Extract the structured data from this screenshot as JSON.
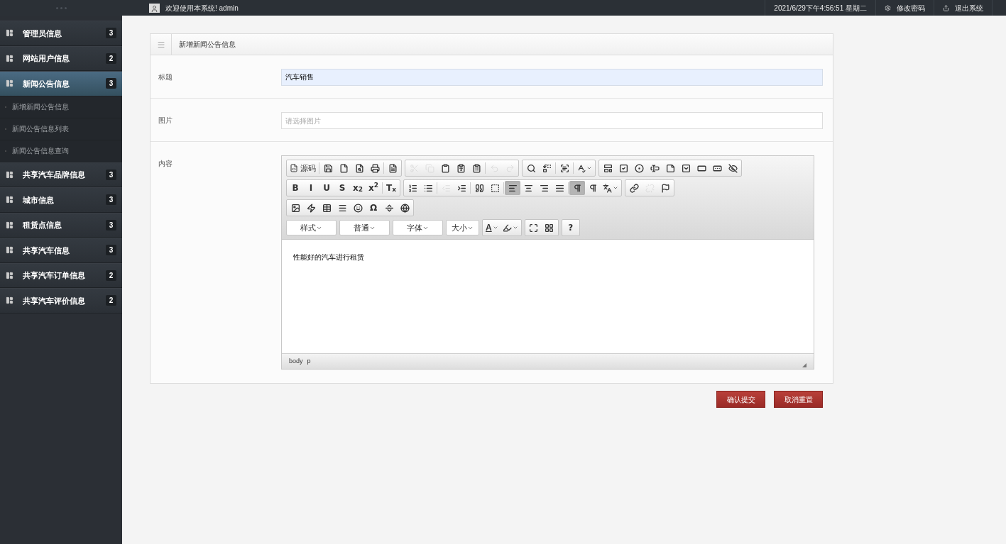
{
  "topbar": {
    "welcome": "欢迎使用本系统! admin",
    "datetime": "2021/6/29下午4:56:51 星期二",
    "links": [
      {
        "kind": "password",
        "label": "修改密码"
      },
      {
        "kind": "logout",
        "label": "退出系统"
      }
    ]
  },
  "sidebar": {
    "items": [
      {
        "label": "管理员信息",
        "count": "3",
        "selected": false
      },
      {
        "label": "网站用户信息",
        "count": "2",
        "selected": false
      },
      {
        "label": "新闻公告信息",
        "count": "3",
        "selected": true,
        "children": [
          {
            "label": "新增新闻公告信息",
            "selected": false
          },
          {
            "label": "新闻公告信息列表",
            "selected": false
          },
          {
            "label": "新闻公告信息查询",
            "selected": false
          }
        ]
      },
      {
        "label": "共享汽车品牌信息",
        "count": "3",
        "selected": false
      },
      {
        "label": "城市信息",
        "count": "3",
        "selected": false
      },
      {
        "label": "租赁点信息",
        "count": "3",
        "selected": false
      },
      {
        "label": "共享汽车信息",
        "count": "3",
        "selected": false
      },
      {
        "label": "共享汽车订单信息",
        "count": "2",
        "selected": false
      },
      {
        "label": "共享汽车评价信息",
        "count": "2",
        "selected": false
      }
    ]
  },
  "form": {
    "title": "新增新闻公告信息",
    "fields": [
      {
        "kind": "text",
        "label": "标题",
        "value": "汽车销售",
        "highlighted": true
      },
      {
        "kind": "text",
        "label": "图片",
        "placeholder": "请选择图片",
        "highlighted": false
      },
      {
        "kind": "editor",
        "label": "内容",
        "value": "性能好的汽车进行租赁",
        "path": [
          "body",
          "p"
        ],
        "toolbar": [
          {
            "groups": [
              {
                "segments": [
                  [
                    {
                      "kind": "text-icon",
                      "label": "源码",
                      "selected": false,
                      "disabled": false
                    }
                  ],
                  [
                    {
                      "kind": "icon",
                      "selected": false,
                      "disabled": false
                    },
                    {
                      "kind": "icon",
                      "selected": false,
                      "disabled": false
                    },
                    {
                      "kind": "icon",
                      "selected": false,
                      "disabled": false
                    },
                    {
                      "kind": "icon",
                      "selected": false,
                      "disabled": false
                    }
                  ],
                  [
                    {
                      "kind": "icon",
                      "selected": false,
                      "disabled": false
                    }
                  ]
                ]
              },
              {
                "segments": [
                  [
                    {
                      "kind": "icon",
                      "selected": false,
                      "disabled": true
                    },
                    {
                      "kind": "icon",
                      "selected": false,
                      "disabled": true
                    },
                    {
                      "kind": "icon",
                      "selected": false,
                      "disabled": false
                    },
                    {
                      "kind": "icon",
                      "selected": false,
                      "disabled": false
                    },
                    {
                      "kind": "icon",
                      "selected": false,
                      "disabled": false
                    }
                  ],
                  [
                    {
                      "kind": "icon",
                      "selected": false,
                      "disabled": true
                    },
                    {
                      "kind": "icon",
                      "selected": false,
                      "disabled": true
                    }
                  ]
                ]
              },
              {
                "segments": [
                  [
                    {
                      "kind": "icon",
                      "selected": false,
                      "disabled": false
                    },
                    {
                      "kind": "icon",
                      "selected": false,
                      "disabled": false
                    }
                  ],
                  [
                    {
                      "kind": "icon",
                      "selected": false,
                      "disabled": false
                    }
                  ],
                  [
                    {
                      "kind": "icon-menu",
                      "selected": false,
                      "disabled": false
                    }
                  ]
                ]
              },
              {
                "segments": [
                  [
                    {
                      "kind": "icon",
                      "selected": false,
                      "disabled": false
                    },
                    {
                      "kind": "icon",
                      "selected": false,
                      "disabled": false
                    },
                    {
                      "kind": "icon",
                      "selected": false,
                      "disabled": false
                    },
                    {
                      "kind": "icon",
                      "selected": false,
                      "disabled": false
                    },
                    {
                      "kind": "icon",
                      "selected": false,
                      "disabled": false
                    },
                    {
                      "kind": "icon",
                      "selected": false,
                      "disabled": false
                    },
                    {
                      "kind": "icon",
                      "selected": false,
                      "disabled": false
                    },
                    {
                      "kind": "icon",
                      "selected": false,
                      "disabled": false
                    },
                    {
                      "kind": "icon",
                      "selected": false,
                      "disabled": false
                    }
                  ]
                ]
              }
            ]
          },
          {
            "groups": [
              {
                "segments": [
                  [
                    {
                      "kind": "text",
                      "label": "B",
                      "selected": false,
                      "disabled": false
                    },
                    {
                      "kind": "text",
                      "label": "I",
                      "selected": false,
                      "disabled": false
                    },
                    {
                      "kind": "text",
                      "label": "U",
                      "selected": false,
                      "disabled": false
                    },
                    {
                      "kind": "text",
                      "label": "S",
                      "selected": false,
                      "disabled": false
                    },
                    {
                      "kind": "text",
                      "label": "x$_{2}$",
                      "selected": false,
                      "disabled": false
                    },
                    {
                      "kind": "text",
                      "label": "x$^{2}$",
                      "selected": false,
                      "disabled": false
                    }
                  ],
                  [
                    {
                      "kind": "text",
                      "label": "T$_{x}$",
                      "selected": false,
                      "disabled": false
                    }
                  ]
                ]
              },
              {
                "segments": [
                  [
                    {
                      "kind": "icon",
                      "selected": false,
                      "disabled": false
                    },
                    {
                      "kind": "icon",
                      "selected": false,
                      "disabled": false
                    }
                  ],
                  [
                    {
                      "kind": "icon",
                      "selected": false,
                      "disabled": true
                    },
                    {
                      "kind": "icon",
                      "selected": false,
                      "disabled": false
                    }
                  ],
                  [
                    {
                      "kind": "icon",
                      "selected": false,
                      "disabled": false
                    },
                    {
                      "kind": "icon",
                      "selected": false,
                      "disabled": false
                    }
                  ],
                  [
                    {
                      "kind": "icon",
                      "selected": true,
                      "disabled": false
                    },
                    {
                      "kind": "icon",
                      "selected": false,
                      "disabled": false
                    },
                    {
                      "kind": "icon",
                      "selected": false,
                      "disabled": false
                    },
                    {
                      "kind": "icon",
                      "selected": false,
                      "disabled": false
                    }
                  ],
                  [
                    {
                      "kind": "icon",
                      "selected": true,
                      "disabled": false
                    },
                    {
                      "kind": "icon",
                      "selected": false,
                      "disabled": false
                    },
                    {
                      "kind": "icon-menu",
                      "selected": false,
                      "disabled": false
                    }
                  ]
                ]
              },
              {
                "segments": [
                  [
                    {
                      "kind": "icon",
                      "selected": false,
                      "disabled": false
                    },
                    {
                      "kind": "icon",
                      "selected": false,
                      "disabled": true
                    },
                    {
                      "kind": "icon",
                      "selected": false,
                      "disabled": false
                    }
                  ]
                ]
              }
            ]
          },
          {
            "groups": [
              {
                "segments": [
                  [
                    {
                      "kind": "icon",
                      "selected": false,
                      "disabled": false
                    },
                    {
                      "kind": "icon",
                      "selected": false,
                      "disabled": false
                    },
                    {
                      "kind": "icon",
                      "selected": false,
                      "disabled": false
                    },
                    {
                      "kind": "icon",
                      "selected": false,
                      "disabled": false
                    },
                    {
                      "kind": "icon",
                      "selected": false,
                      "disabled": false
                    },
                    {
                      "kind": "text",
                      "label": "Ω",
                      "selected": false,
                      "disabled": false
                    },
                    {
                      "kind": "icon",
                      "selected": false,
                      "disabled": false
                    },
                    {
                      "kind": "icon",
                      "selected": false,
                      "disabled": false
                    }
                  ]
                ]
              }
            ]
          },
          {
            "groups": [
              {
                "segments": [
                  [
                    {
                      "kind": "combo",
                      "label": "样式"
                    }
                  ]
                ]
              },
              {
                "segments": [
                  [
                    {
                      "kind": "combo",
                      "label": "普通"
                    }
                  ]
                ]
              },
              {
                "segments": [
                  [
                    {
                      "kind": "combo",
                      "label": "字体"
                    }
                  ]
                ]
              },
              {
                "segments": [
                  [
                    {
                      "kind": "small-combo",
                      "label": "大小"
                    }
                  ]
                ]
              },
              {
                "segments": [
                  [
                    {
                      "kind": "text-menu",
                      "label": "A",
                      "selected": false,
                      "disabled": false
                    },
                    {
                      "kind": "icon-menu",
                      "selected": false,
                      "disabled": false
                    }
                  ]
                ]
              },
              {
                "segments": [
                  [
                    {
                      "kind": "icon",
                      "selected": false,
                      "disabled": false
                    },
                    {
                      "kind": "icon",
                      "selected": false,
                      "disabled": false
                    }
                  ]
                ]
              },
              {
                "segments": [
                  [
                    {
                      "kind": "text",
                      "label": "?",
                      "selected": false,
                      "disabled": false
                    }
                  ]
                ]
              }
            ]
          }
        ]
      }
    ]
  },
  "buttons": [
    "确认提交",
    "取消重置"
  ]
}
